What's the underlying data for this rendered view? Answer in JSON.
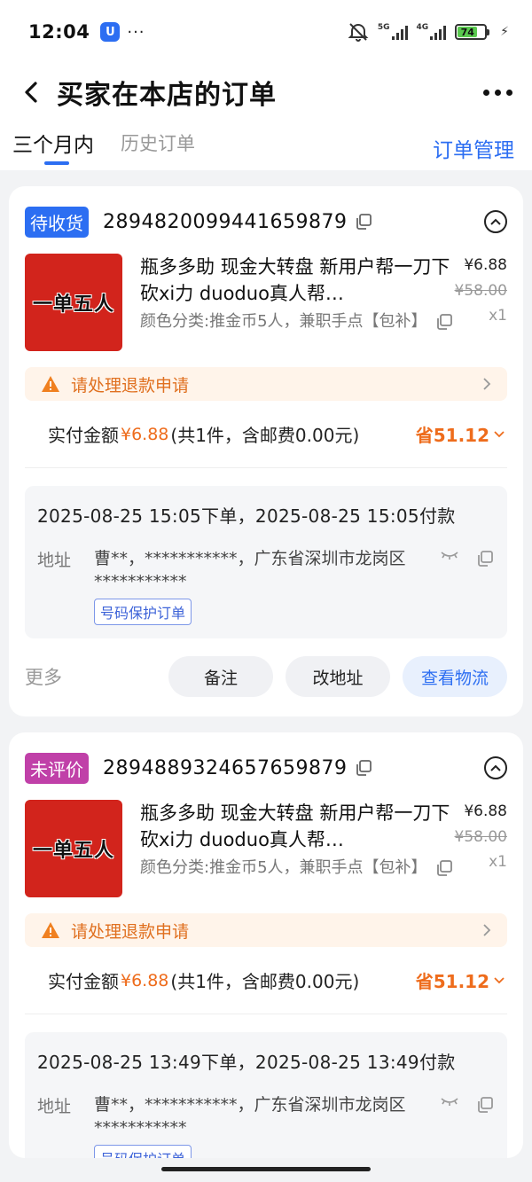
{
  "status_bar": {
    "time": "12:04",
    "app_indicator": "U",
    "extra_dots": "···",
    "net1": "5G",
    "net2": "4G",
    "battery": "74"
  },
  "header": {
    "title": "买家在本店的订单"
  },
  "tabs": {
    "active": "三个月内",
    "inactive": "历史订单",
    "manage": "订单管理"
  },
  "orders": [
    {
      "status": "待收货",
      "status_color": "#2c6ef2",
      "order_no": "2894820099441659879",
      "thumb_text": "一单五人",
      "title": "瓶多多助 现金大转盘 新用户帮一刀下砍xi力 duoduo真人帮…",
      "sku": "颜色分类:推金币5人，兼职手点【包补】",
      "price": "¥6.88",
      "orig_price": "¥58.00",
      "qty": "x1",
      "refund_text": "请处理退款申请",
      "pay_label": "实付金额",
      "pay_amount": "¥6.88",
      "pay_extra": "(共1件，含邮费0.00元)",
      "save": "省51.12",
      "time_line": "2025-08-25 15:05下单，2025-08-25 15:05付款",
      "addr_label": "地址",
      "addr": "曹**，***********，广东省深圳市龙岗区***********",
      "protect": "号码保护订单",
      "more": "更多",
      "btn_note": "备注",
      "btn_addr": "改地址",
      "btn_logistics": "查看物流"
    },
    {
      "status": "未评价",
      "status_color": "#c040a8",
      "order_no": "2894889324657659879",
      "thumb_text": "一单五人",
      "title": "瓶多多助 现金大转盘 新用户帮一刀下砍xi力 duoduo真人帮…",
      "sku": "颜色分类:推金币5人，兼职手点【包补】",
      "price": "¥6.88",
      "orig_price": "¥58.00",
      "qty": "x1",
      "refund_text": "请处理退款申请",
      "pay_label": "实付金额",
      "pay_amount": "¥6.88",
      "pay_extra": "(共1件，含邮费0.00元)",
      "save": "省51.12",
      "time_line": "2025-08-25 13:49下单，2025-08-25 13:49付款",
      "addr_label": "地址",
      "addr": "曹**，***********，广东省深圳市龙岗区***********",
      "protect": "号码保护订单"
    }
  ]
}
